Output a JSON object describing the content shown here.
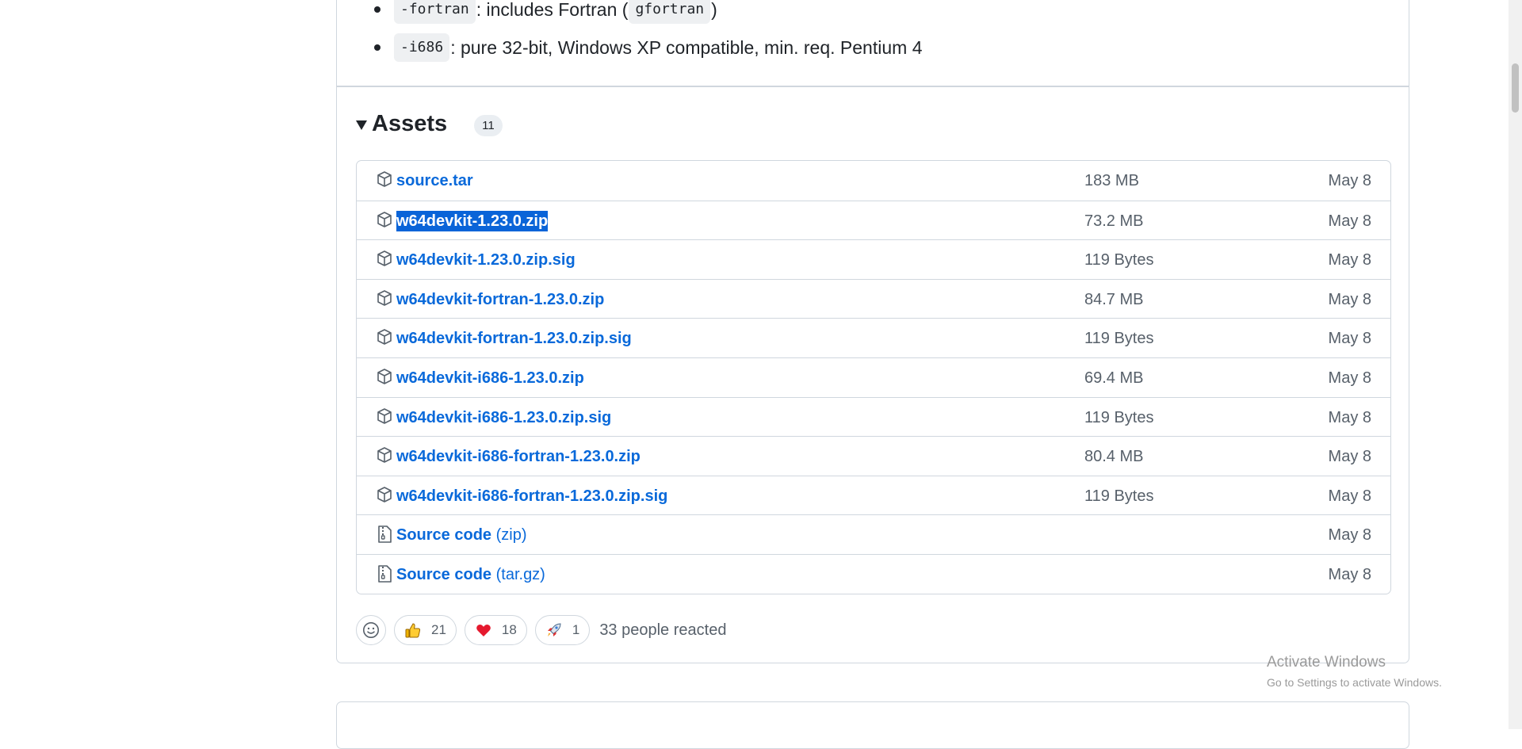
{
  "notes": [
    {
      "code": "-fortran",
      "text_before": ": includes Fortran (",
      "code2": "gfortran",
      "text_after": ")"
    },
    {
      "code": "-i686",
      "text": ": pure 32-bit, Windows XP compatible, min. req. Pentium 4"
    }
  ],
  "assets": {
    "title": "Assets",
    "count": "11",
    "rows": [
      {
        "name": "source.tar",
        "size": "183 MB",
        "date": "May 8",
        "icon": "package-icon"
      },
      {
        "name": "w64devkit-1.23.0.zip",
        "size": "73.2 MB",
        "date": "May 8",
        "icon": "package-icon",
        "selected": true
      },
      {
        "name": "w64devkit-1.23.0.zip.sig",
        "size": "119 Bytes",
        "date": "May 8",
        "icon": "package-icon"
      },
      {
        "name": "w64devkit-fortran-1.23.0.zip",
        "size": "84.7 MB",
        "date": "May 8",
        "icon": "package-icon"
      },
      {
        "name": "w64devkit-fortran-1.23.0.zip.sig",
        "size": "119 Bytes",
        "date": "May 8",
        "icon": "package-icon"
      },
      {
        "name": "w64devkit-i686-1.23.0.zip",
        "size": "69.4 MB",
        "date": "May 8",
        "icon": "package-icon"
      },
      {
        "name": "w64devkit-i686-1.23.0.zip.sig",
        "size": "119 Bytes",
        "date": "May 8",
        "icon": "package-icon"
      },
      {
        "name": "w64devkit-i686-fortran-1.23.0.zip",
        "size": "80.4 MB",
        "date": "May 8",
        "icon": "package-icon"
      },
      {
        "name": "w64devkit-i686-fortran-1.23.0.zip.sig",
        "size": "119 Bytes",
        "date": "May 8",
        "icon": "package-icon"
      },
      {
        "name": "Source code",
        "suffix": "(zip)",
        "size": "",
        "date": "May 8",
        "icon": "file-zip-icon"
      },
      {
        "name": "Source code",
        "suffix": "(tar.gz)",
        "size": "",
        "date": "May 8",
        "icon": "file-zip-icon"
      }
    ]
  },
  "reactions": {
    "thumbs_up": "21",
    "heart": "18",
    "rocket": "1",
    "summary": "33 people reacted"
  },
  "watermark": {
    "title": "Activate Windows",
    "subtitle": "Go to Settings to activate Windows."
  },
  "colors": {
    "link": "#0969da",
    "selection": "#0a64d8",
    "border": "#d0d7de",
    "muted": "#57606a"
  }
}
